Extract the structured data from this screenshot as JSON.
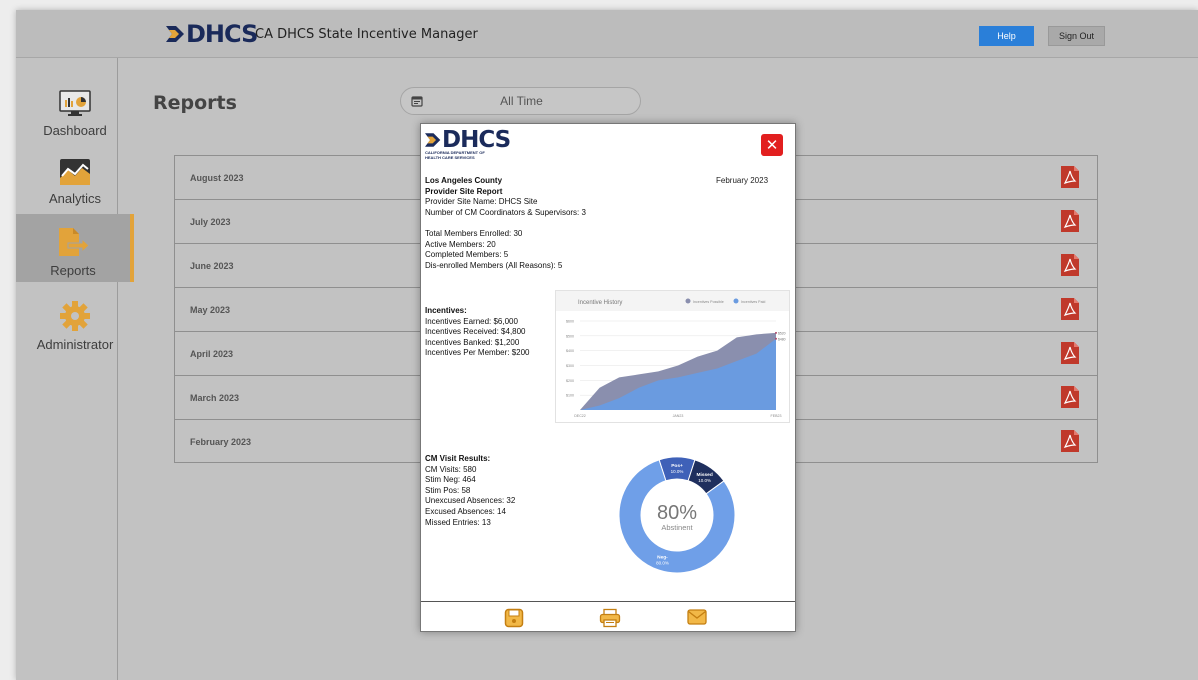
{
  "app": {
    "title": "CA DHCS State Incentive Manager",
    "logo_text": "DHCS"
  },
  "header": {
    "help_label": "Help",
    "signout_label": "Sign Out"
  },
  "sidebar": {
    "items": [
      {
        "label": "Dashboard",
        "icon": "dashboard-monitor-icon"
      },
      {
        "label": "Analytics",
        "icon": "analytics-chart-icon"
      },
      {
        "label": "Reports",
        "icon": "reports-document-icon",
        "active": true
      },
      {
        "label": "Administrator",
        "icon": "gear-icon"
      }
    ]
  },
  "page": {
    "title": "Reports",
    "date_filter": "All Time"
  },
  "reports": [
    {
      "label": "August 2023"
    },
    {
      "label": "July 2023"
    },
    {
      "label": "June 2023"
    },
    {
      "label": "May 2023"
    },
    {
      "label": "April 2023"
    },
    {
      "label": "March 2023"
    },
    {
      "label": "February 2023"
    }
  ],
  "modal": {
    "logo_text": "DHCS",
    "logo_sub1": "CALIFORNIA DEPARTMENT OF",
    "logo_sub2": "HEALTH CARE SERVICES",
    "date": "February 2023",
    "county": "Los Angeles County",
    "report_title": "Provider Site Report",
    "site_name": "Provider Site Name: DHCS Site",
    "coordinators": "Number of CM Coordinators & Supervisors: 3",
    "total_members": "Total Members Enrolled: 30",
    "active_members": "Active Members: 20",
    "completed_members": "Completed Members: 5",
    "disenrolled_members": "Dis-enrolled Members (All Reasons): 5",
    "incentives_heading": "Incentives:",
    "incentives_earned": "Incentives Earned: $6,000",
    "incentives_received": "Incentives Received: $4,800",
    "incentives_banked": "Incentives Banked: $1,200",
    "incentives_per_member": "Incentives Per Member: $200",
    "cm_heading": "CM Visit Results:",
    "cm_visits": "CM Visits: 580",
    "stim_neg": "Stim Neg: 464",
    "stim_pos": "Stim Pos: 58",
    "unexcused": "Unexcused Absences: 32",
    "excused": "Excused Absences: 14",
    "missed": "Missed Entries: 13",
    "footer_icons": [
      "save-icon",
      "print-icon",
      "email-icon"
    ]
  },
  "chart_data": [
    {
      "type": "area",
      "title": "Incentive History",
      "series": [
        {
          "name": "Incentives Possible",
          "color": "#8a8fae",
          "values": [
            0,
            150,
            220,
            240,
            260,
            300,
            360,
            400,
            490,
            510,
            520
          ]
        },
        {
          "name": "Incentives Paid",
          "color": "#6a9be0",
          "values": [
            0,
            30,
            80,
            150,
            200,
            220,
            250,
            280,
            330,
            380,
            480
          ]
        }
      ],
      "x_tick_labels": [
        "DEC22",
        "JAN23",
        "FEB23"
      ],
      "y_tick_labels": [
        "$100",
        "$200",
        "$300",
        "$400",
        "$500",
        "$600"
      ],
      "ylim": [
        0,
        600
      ],
      "end_labels": [
        "$520",
        "$480"
      ],
      "legend_position": "top-right"
    },
    {
      "type": "pie",
      "center_value": "80%",
      "center_label": "Abstinent",
      "slices": [
        {
          "name": "Neg-",
          "label": "Neg-",
          "value": 80.0,
          "pct_label": "80.0%",
          "color": "#6f9fe8"
        },
        {
          "name": "Pos+",
          "label": "Pos+",
          "value": 10.0,
          "pct_label": "10.0%",
          "color": "#3f61b8"
        },
        {
          "name": "Missed",
          "label": "Missed",
          "value": 10.0,
          "pct_label": "10.0%",
          "color": "#1f2f5e"
        }
      ]
    }
  ]
}
